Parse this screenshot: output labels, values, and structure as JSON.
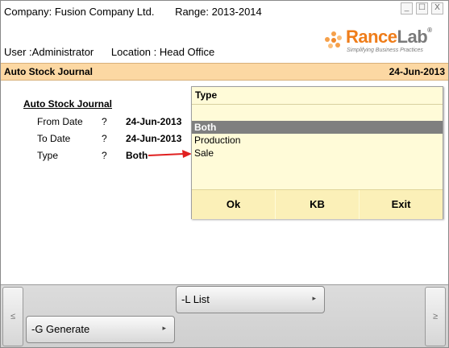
{
  "header": {
    "company": "Company: Fusion Company Ltd.",
    "range": "Range: 2013-2014",
    "user": "User :Administrator",
    "location": "Location : Head Office",
    "window_controls": [
      "_",
      "☐",
      "X"
    ]
  },
  "logo": {
    "name_part1": "Rance",
    "name_part2": "Lab",
    "registered": "®",
    "tagline": "Simplifying Business Practices",
    "accent_color": "#ef7d1a"
  },
  "titlebar": {
    "title": "Auto Stock Journal",
    "date": "24-Jun-2013",
    "color": "#fcd8a3"
  },
  "form": {
    "heading": "Auto Stock Journal",
    "rows": [
      {
        "label": "From Date",
        "q": "?",
        "value": "24-Jun-2013"
      },
      {
        "label": "To Date",
        "q": "?",
        "value": "24-Jun-2013"
      },
      {
        "label": "Type",
        "q": "?",
        "value": "Both"
      }
    ]
  },
  "popup": {
    "title": "Type",
    "input_value": "",
    "options": [
      "Both",
      "Production",
      "Sale"
    ],
    "selected": "Both",
    "buttons": [
      "Ok",
      "KB",
      "Exit"
    ]
  },
  "toolbar": {
    "list_label": "-L List",
    "generate_label": "-G Generate",
    "left_scroll": "≤",
    "right_scroll": "≥",
    "chevron": "▸"
  }
}
